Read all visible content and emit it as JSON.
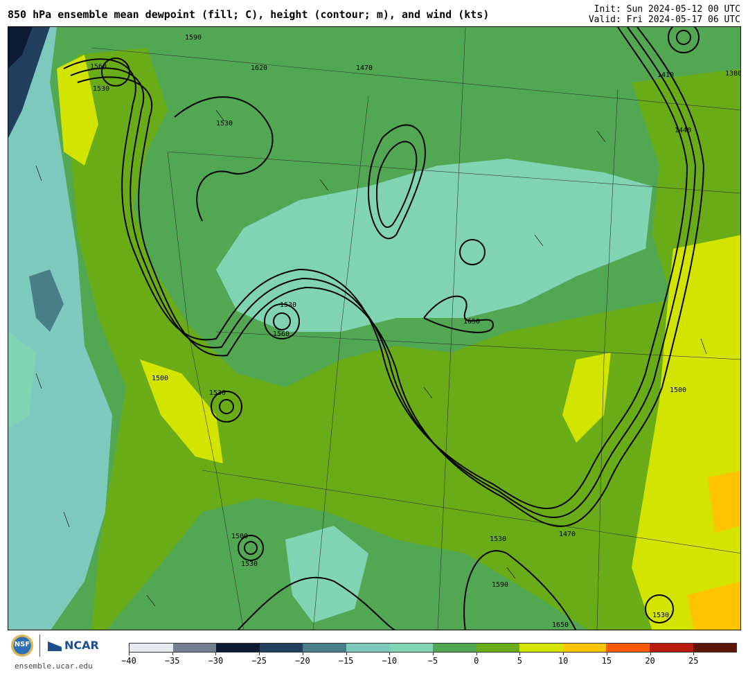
{
  "header": {
    "title": "850 hPa ensemble mean dewpoint (fill; C), height (contour; m), and wind (kts)",
    "init": "Init: Sun 2024-05-12 00 UTC",
    "valid": "Valid: Fri 2024-05-17 06 UTC"
  },
  "footer": {
    "site": "ensemble.ucar.edu",
    "nsf_logo": "NSF",
    "ncar_logo": "NCAR"
  },
  "legend": {
    "colors": [
      "#e6eaf0",
      "#737f91",
      "#0d1a33",
      "#22405e",
      "#487e87",
      "#7ec9bd",
      "#80d4b3",
      "#52a852",
      "#6aac18",
      "#d3e400",
      "#ffc400",
      "#fc5a00",
      "#b81c0c",
      "#5e1607"
    ],
    "ticks": [
      "−40",
      "−35",
      "−30",
      "−25",
      "−20",
      "−15",
      "−10",
      "−5",
      "0",
      "5",
      "10",
      "15",
      "20",
      "25"
    ]
  },
  "contour_labels": [
    "1560",
    "1530",
    "1590",
    "1620",
    "1470",
    "1500",
    "1650",
    "1410",
    "1440",
    "1380"
  ]
}
